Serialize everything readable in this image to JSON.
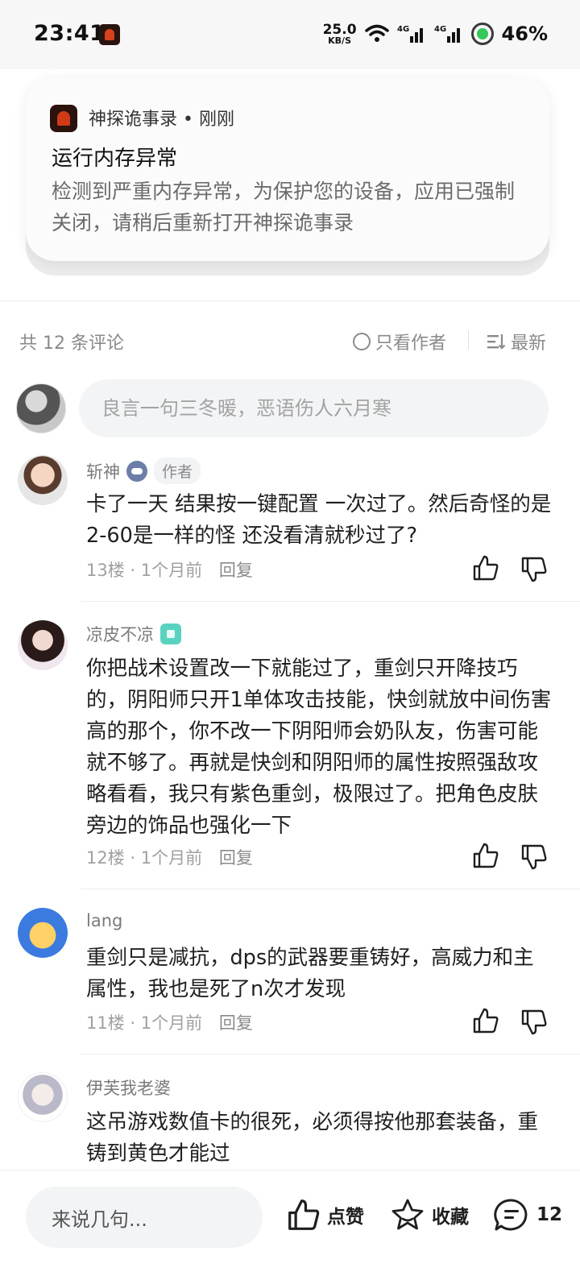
{
  "status_bar": {
    "time": "23:41",
    "net_speed_value": "25.0",
    "net_speed_unit": "KB/S",
    "signal1": "4G",
    "signal2": "4G",
    "battery": "46%"
  },
  "notification": {
    "app_name": "神探诡事录",
    "time": "刚刚",
    "title": "运行内存异常",
    "body": "检测到严重内存异常，为保护您的设备，应用已强制关闭，请稍后重新打开神探诡事录"
  },
  "comments_header": {
    "count": "共 12 条评论",
    "author_only": "只看作者",
    "sort": "最新"
  },
  "comment_input": {
    "placeholder": "良言一句三冬暖，恶语伤人六月寒"
  },
  "comments": [
    {
      "username": "斩神",
      "badge": "game-controller-badge",
      "author_tag": "作者",
      "text": "卡了一天  结果按一键配置 一次过了。然后奇怪的是2-60是一样的怪 还没看清就秒过了?",
      "floor": "13楼",
      "time": "1个月前",
      "reply": "回复"
    },
    {
      "username": "凉皮不凉",
      "badge": "gem-badge",
      "text": "你把战术设置改一下就能过了，重剑只开降技巧的，阴阳师只开1单体攻击技能，快剑就放中间伤害高的那个，你不改一下阴阳师会奶队友，伤害可能就不够了。再就是快剑和阴阳师的属性按照强敌攻略看看，我只有紫色重剑，极限过了。把角色皮肤旁边的饰品也强化一下",
      "floor": "12楼",
      "time": "1个月前",
      "reply": "回复"
    },
    {
      "username": "lang",
      "text": "重剑只是减抗，dps的武器要重铸好，高威力和主属性，我也是死了n次才发现",
      "floor": "11楼",
      "time": "1个月前",
      "reply": "回复"
    },
    {
      "username": "伊芙我老婆",
      "text": "这吊游戏数值卡的很死，必须得按他那套装备，重铸到黄色才能过"
    }
  ],
  "bottom_bar": {
    "input_placeholder": "来说几句...",
    "like_label": "点赞",
    "favorite_label": "收藏",
    "comment_count": "12"
  },
  "colors": {
    "text_primary": "#1f1f1f",
    "text_secondary": "#8a8a8a",
    "input_bg": "#f3f4f6"
  }
}
